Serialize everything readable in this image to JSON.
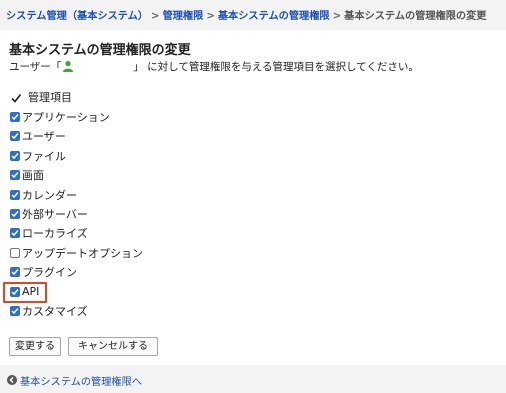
{
  "breadcrumb": {
    "items": [
      "システム管理（基本システム）",
      "管理権限",
      "基本システムの管理権限"
    ],
    "separator": ">",
    "current": "基本システムの管理権限の変更"
  },
  "page": {
    "title": "基本システムの管理権限の変更",
    "desc_prefix": "ユーザー「",
    "desc_suffix": "」 に対して管理権限を与える管理項目を選択してください。"
  },
  "items": {
    "header": "管理項目",
    "list": [
      {
        "label": "アプリケーション",
        "checked": true
      },
      {
        "label": "ユーザー",
        "checked": true
      },
      {
        "label": "ファイル",
        "checked": true
      },
      {
        "label": "画面",
        "checked": true
      },
      {
        "label": "カレンダー",
        "checked": true
      },
      {
        "label": "外部サーバー",
        "checked": true
      },
      {
        "label": "ローカライズ",
        "checked": true
      },
      {
        "label": "アップデートオプション",
        "checked": false
      },
      {
        "label": "プラグイン",
        "checked": true
      },
      {
        "label": "API",
        "checked": true
      },
      {
        "label": "カスタマイズ",
        "checked": true
      }
    ]
  },
  "buttons": {
    "submit": "変更する",
    "cancel": "キャンセルする"
  },
  "footer": {
    "back_link": "基本システムの管理権限へ"
  },
  "colors": {
    "link": "#1a4fb5",
    "checkbox": "#2f6fc8",
    "highlight": "#e2471c",
    "user_icon": "#3fa33a"
  }
}
